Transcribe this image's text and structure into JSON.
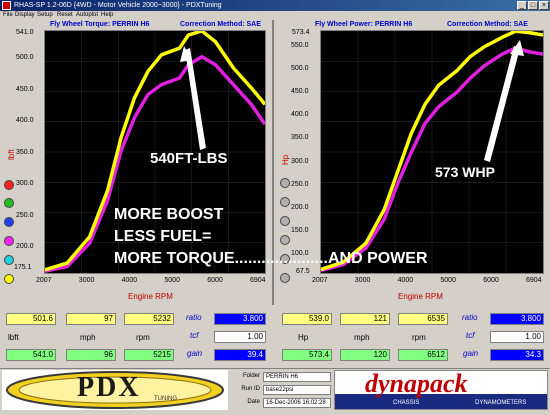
{
  "window": {
    "title": "RHAS-SP 1.2-06D {4WD - Motor Vehicle 2000~3000} - PDXTuning"
  },
  "menu": [
    "File",
    "Display",
    "Setup",
    "Reset",
    "Autoplot",
    "Help"
  ],
  "left_panel": {
    "title": "Fly Wheel Torque: PERRIN H6",
    "correction": "Correction Method: SAE",
    "ylabel": "lbft",
    "xlabel": "Engine RPM",
    "y_top": "541.0",
    "y_ticks": [
      "500.0",
      "450.0",
      "400.0",
      "350.0",
      "300.0",
      "250.0",
      "200.0"
    ],
    "y_bottom": "175.1",
    "x_ticks": [
      "2007",
      "3000",
      "4000",
      "5000",
      "6000",
      "6904"
    ]
  },
  "right_panel": {
    "title": "Fly Wheel Power: PERRIN H6",
    "correction": "Correction Method: SAE",
    "ylabel": "Hp",
    "xlabel": "Engine RPM",
    "y_top": "573.4",
    "y_ticks": [
      "550.0",
      "500.0",
      "450.0",
      "400.0",
      "350.0",
      "300.0",
      "250.0",
      "200.0",
      "150.0",
      "100.0"
    ],
    "y_bottom": "67.5",
    "x_ticks": [
      "2007",
      "3000",
      "4000",
      "5000",
      "6000",
      "6904"
    ]
  },
  "annotations": {
    "torque": "540FT-LBS",
    "power": "573 WHP",
    "boost_line1": "MORE BOOST",
    "boost_line2": "LESS FUEL=",
    "boost_line3": "MORE TORQUE.....................AND POWER"
  },
  "readouts_left": {
    "row1": {
      "lbft": "501.6",
      "mph": "97",
      "rpm": "5232"
    },
    "labels": {
      "lbft": "lbft",
      "mph": "mph",
      "rpm": "rpm"
    },
    "row2": {
      "lbft": "541.0",
      "mph": "96",
      "rpm": "5215"
    },
    "ratio_label": "ratio",
    "ratio": "3.800",
    "tcf_label": "tcf",
    "tcf": "1.00",
    "gain_label": "gain",
    "gain": "39.4"
  },
  "readouts_right": {
    "row1": {
      "hp": "539.0",
      "mph": "121",
      "rpm": "6535"
    },
    "labels": {
      "hp": "Hp",
      "mph": "mph",
      "rpm": "rpm"
    },
    "row2": {
      "hp": "573.4",
      "mph": "120",
      "rpm": "6512"
    },
    "ratio_label": "ratio",
    "ratio": "3.800",
    "tcf_label": "tcf",
    "tcf": "1.00",
    "gain_label": "gain",
    "gain": "34.3"
  },
  "info": {
    "folder_label": "Folder",
    "folder": "PERRIN H6",
    "runid_label": "Run ID",
    "runid": "base22psi",
    "date_label": "Date",
    "date": "16-Dec-2006  16:02:28"
  },
  "logos": {
    "pdx": "PDX",
    "pdx_sub": "TUNING",
    "dynapack": "dynapack",
    "dynapack_sub1": "CHASSIS",
    "dynapack_sub2": "DYNAMOMETERS"
  },
  "colors": {
    "yellow_curve": "#ffff00",
    "magenta_curve": "#e020e0",
    "plot_bg": "#000000",
    "grid": "#303030"
  },
  "chart_data": [
    {
      "type": "line",
      "title": "Fly Wheel Torque: PERRIN H6",
      "xlabel": "Engine RPM",
      "ylabel": "lbft",
      "xlim": [
        2007,
        6904
      ],
      "ylim": [
        175.1,
        541.0
      ],
      "series": [
        {
          "x": [
            2007,
            2500,
            3000,
            3400,
            3700,
            4000,
            4300,
            4600,
            5000,
            5200,
            5500,
            5800,
            6200,
            6600,
            6904
          ],
          "values": [
            180,
            190,
            230,
            300,
            380,
            440,
            480,
            505,
            515,
            535,
            541,
            525,
            485,
            455,
            430
          ]
        },
        {
          "x": [
            2007,
            2500,
            3000,
            3400,
            3700,
            4000,
            4300,
            4600,
            5000,
            5200,
            5500,
            5800,
            6200,
            6600,
            6904
          ],
          "values": [
            178,
            185,
            220,
            285,
            360,
            410,
            445,
            460,
            470,
            490,
            502,
            490,
            460,
            430,
            400
          ]
        }
      ]
    },
    {
      "type": "line",
      "title": "Fly Wheel Power: PERRIN H6",
      "xlabel": "Engine RPM",
      "ylabel": "Hp",
      "xlim": [
        2007,
        6904
      ],
      "ylim": [
        67.5,
        573.4
      ],
      "series": [
        {
          "x": [
            2007,
            2500,
            3000,
            3400,
            3700,
            4000,
            4300,
            4600,
            5000,
            5300,
            5600,
            6000,
            6300,
            6600,
            6904
          ],
          "values": [
            75,
            90,
            130,
            200,
            280,
            360,
            420,
            460,
            490,
            520,
            540,
            560,
            573,
            570,
            565
          ]
        },
        {
          "x": [
            2007,
            2500,
            3000,
            3400,
            3700,
            4000,
            4300,
            4600,
            5000,
            5300,
            5600,
            6000,
            6300,
            6600,
            6904
          ],
          "values": [
            73,
            85,
            120,
            180,
            255,
            320,
            380,
            415,
            445,
            475,
            500,
            525,
            538,
            530,
            525
          ]
        }
      ]
    }
  ]
}
